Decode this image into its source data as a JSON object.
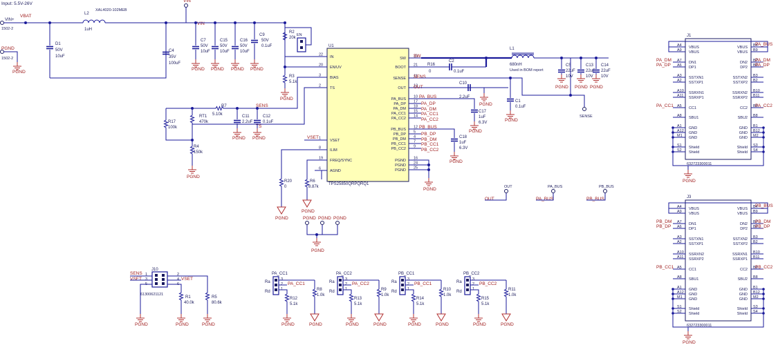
{
  "input_note": "Input: 5.5V-26V",
  "nets": {
    "vin_plus": "VIN+",
    "vbat": "VBAT",
    "vin": "VIN",
    "pgnd": "PGND",
    "en": "EN",
    "sw": "SW",
    "sens": "SENS",
    "ts": "TS",
    "out": "OUT",
    "vset": "VSET",
    "pa_bus": "PA_BUS",
    "pa_dp": "PA_DP",
    "pa_dm": "PA_DM",
    "pa_cc1": "PA_CC1",
    "pa_cc2": "PA_CC2",
    "pb_bus": "PB_BUS",
    "pb_dp": "PB_DP",
    "pb_dm": "PB_DM",
    "pb_cc1": "PB_CC1",
    "pb_cc2": "PB_CC2",
    "sense": "SENSE"
  },
  "connectors": {
    "vin_plus_part": "1502-2",
    "pgnd_part": "1502-2"
  },
  "components": {
    "l2": {
      "ref": "L2",
      "value": "1uH",
      "part": "XAL4020-102MEB"
    },
    "d1": {
      "ref": "D1",
      "v1": "50V",
      "v2": "10uF"
    },
    "c4": {
      "ref": "C4",
      "v1": "35V",
      "v2": "100uF"
    },
    "c7": {
      "ref": "C7",
      "v1": "50V",
      "v2": "10uF"
    },
    "c15": {
      "ref": "C15",
      "v1": "50V",
      "v2": "10uF"
    },
    "c16": {
      "ref": "C16",
      "v1": "50V",
      "v2": "10uF"
    },
    "c9": {
      "ref": "C9",
      "v1": "50V",
      "v2": "0.1uF"
    },
    "r2": {
      "ref": "R2",
      "value": "20k"
    },
    "r3": {
      "ref": "R3",
      "value": "5.1k"
    },
    "r16": {
      "ref": "R16",
      "value": "0"
    },
    "c2": {
      "ref": "C2",
      "value": "0.1uF"
    },
    "l1": {
      "ref": "L1",
      "value": "680nH",
      "note": "Used in BOM report"
    },
    "c5": {
      "ref": "C5",
      "v1": "22uF",
      "v2": "10V"
    },
    "c13": {
      "ref": "C13",
      "v1": "22uF",
      "v2": "10V"
    },
    "c14": {
      "ref": "C14",
      "v1": "22uF",
      "v2": "10V"
    },
    "c10": {
      "ref": "C10",
      "value": "2.2uF"
    },
    "c1": {
      "ref": "C1",
      "value": "0.1uF"
    },
    "c17": {
      "ref": "C17",
      "v1": "1uF",
      "v2": "6.3V"
    },
    "c18": {
      "ref": "C18",
      "v1": "1uF",
      "v2": "6.3V"
    },
    "rt1": {
      "ref": "RT1",
      "value": "470k"
    },
    "r7": {
      "ref": "R7",
      "value": "5.10k"
    },
    "r17": {
      "ref": "R17",
      "value": "100k"
    },
    "r4": {
      "ref": "R4",
      "value": "150k"
    },
    "c11": {
      "ref": "C11",
      "value": "2.2uF"
    },
    "c12": {
      "ref": "C12",
      "value": "0.1uF"
    },
    "r20": {
      "ref": "R20",
      "value": "0"
    },
    "r6": {
      "ref": "R6",
      "value": "8.87k"
    },
    "r1": {
      "ref": "R1",
      "value": "40.0k"
    },
    "r5": {
      "ref": "R5",
      "value": "80.6k"
    },
    "j10": {
      "ref": "J10",
      "part": "61300621121"
    }
  },
  "u1": {
    "ref": "U1",
    "part": "TPS25850QRPQRQ1",
    "left_pins": [
      {
        "num": "22",
        "name": "IN"
      },
      {
        "num": "20",
        "name": "EN/UV"
      },
      {
        "num": "3",
        "name": "BIAS"
      },
      {
        "num": "2",
        "name": "TS"
      },
      {
        "num": "1",
        "name": "VSET"
      },
      {
        "num": "8",
        "name": "ILIM"
      },
      {
        "num": "19",
        "name": "FREQ/SYNC"
      },
      {
        "num": "6",
        "name": "AGND"
      }
    ],
    "right_pins": [
      {
        "num": "23",
        "name": "SW"
      },
      {
        "num": "21",
        "name": "BOOT"
      },
      {
        "num": "11",
        "name": "SENSE"
      },
      {
        "num": "13",
        "name": "OUT"
      },
      {
        "num": "10",
        "name": "PA_BUS"
      },
      {
        "num": "17",
        "name": "PA_DP"
      },
      {
        "num": "18",
        "name": "PA_DM"
      },
      {
        "num": "15",
        "name": "PA_CC1"
      },
      {
        "num": "14",
        "name": "PA_CC2"
      },
      {
        "num": "12",
        "name": "PB_BUS"
      },
      {
        "num": "5",
        "name": "PB_DP"
      },
      {
        "num": "4",
        "name": "PB_DM"
      },
      {
        "num": "7",
        "name": "PB_CC1"
      },
      {
        "num": "9",
        "name": "PB_CC2"
      },
      {
        "num": "16",
        "name": "PGND"
      },
      {
        "num": "24",
        "name": "PGND"
      },
      {
        "num": "25",
        "name": "PGND"
      }
    ]
  },
  "usb_connectors": [
    {
      "ref": "J1",
      "part": "632723300011",
      "prefix": "PA",
      "left": [
        [
          "A4",
          "VBUS"
        ],
        [
          "A9",
          "VBUS"
        ],
        [
          "A7",
          "DN1"
        ],
        [
          "A6",
          "DP1"
        ],
        [
          "A3",
          "SSTXN1"
        ],
        [
          "A2",
          "SSTXP1"
        ],
        [
          "A10",
          "SSRXN1"
        ],
        [
          "A11",
          "SSRXP1"
        ],
        [
          "A5",
          "CC1"
        ],
        [
          "A8",
          "SBU1"
        ],
        [
          "A1",
          "GND"
        ],
        [
          "A12",
          "GND"
        ],
        [
          "M1",
          "GND"
        ],
        [
          "S1",
          "Shield"
        ],
        [
          "S2",
          "Shield"
        ]
      ],
      "right": [
        [
          "B4",
          "VBUS"
        ],
        [
          "B9",
          "VBUS"
        ],
        [
          "B7",
          "DN2"
        ],
        [
          "B6",
          "DP2"
        ],
        [
          "B3",
          "SSTXN2"
        ],
        [
          "B2",
          "SSTXP2"
        ],
        [
          "B10",
          "SSRXN2"
        ],
        [
          "B11",
          "SSRXP2"
        ],
        [
          "B5",
          "CC2"
        ],
        [
          "B8",
          "SBU2"
        ],
        [
          "B1",
          "GND"
        ],
        [
          "B12",
          "GND"
        ],
        [
          "M2",
          "GND"
        ],
        [
          "S3",
          "Shield"
        ],
        [
          "S4",
          "Shield"
        ]
      ]
    },
    {
      "ref": "J3",
      "part": "632723300011",
      "prefix": "PB",
      "left": [
        [
          "A4",
          "VBUS"
        ],
        [
          "A9",
          "VBUS"
        ],
        [
          "A7",
          "DN1"
        ],
        [
          "A6",
          "DP1"
        ],
        [
          "A3",
          "SSTXN1"
        ],
        [
          "A2",
          "SSTXP1"
        ],
        [
          "A10",
          "SSRXN2"
        ],
        [
          "A11",
          "SSRXP2"
        ],
        [
          "A5",
          "CC1"
        ],
        [
          "A8",
          "SBU1"
        ],
        [
          "A1",
          "GND"
        ],
        [
          "A12",
          "GND"
        ],
        [
          "M1",
          "GND"
        ],
        [
          "S1",
          "Shield"
        ],
        [
          "S2",
          "Shield"
        ]
      ],
      "right": [
        [
          "B4",
          "VBUS"
        ],
        [
          "B9",
          "VBUS"
        ],
        [
          "B7",
          "DN2"
        ],
        [
          "B6",
          "DP2"
        ],
        [
          "B3",
          "SSTXN2"
        ],
        [
          "B2",
          "SSTXP2"
        ],
        [
          "B10",
          "SSRXN1"
        ],
        [
          "B11",
          "SSRXP1"
        ],
        [
          "B5",
          "CC2"
        ],
        [
          "B8",
          "SBU2"
        ],
        [
          "B1",
          "GND"
        ],
        [
          "B12",
          "GND"
        ],
        [
          "M2",
          "GND"
        ],
        [
          "S3",
          "Shield"
        ],
        [
          "S4",
          "Shield"
        ]
      ]
    }
  ],
  "cc_headers": [
    {
      "ref": "PA_CC1",
      "net": "PA_CC1",
      "r_pd": {
        "ref": "R12",
        "value": "5.1k"
      },
      "r_pu": {
        "ref": "R8",
        "value": "1.0k"
      }
    },
    {
      "ref": "PA_CC2",
      "net": "PA_CC2",
      "r_pd": {
        "ref": "R13",
        "value": "5.1k"
      },
      "r_pu": {
        "ref": "R9",
        "value": "1.0k"
      }
    },
    {
      "ref": "PB_CC1",
      "net": "PB_CC1",
      "r_pd": {
        "ref": "R14",
        "value": "5.1k"
      },
      "r_pu": {
        "ref": "R10",
        "value": "1.0k"
      }
    },
    {
      "ref": "PB_CC2",
      "net": "PB_CC2",
      "r_pd": {
        "ref": "R15",
        "value": "5.1k"
      },
      "r_pu": {
        "ref": "R11",
        "value": "1.0k"
      }
    }
  ],
  "header_labels": {
    "ra": "Ra",
    "rd": "Rd",
    "p1": "1",
    "p2": "2",
    "p3": "3"
  }
}
